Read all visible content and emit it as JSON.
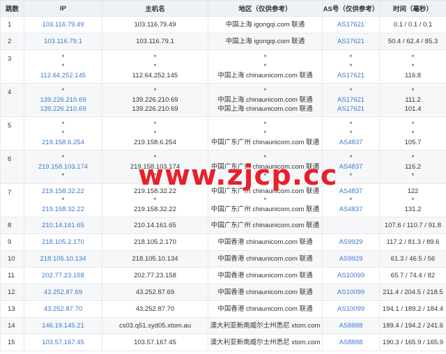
{
  "columns": {
    "hop": "跳数",
    "ip": "IP",
    "hostname": "主机名",
    "region": "地区（仅供参考）",
    "asn": "AS号（仅供参考）",
    "time": "时间（毫秒）"
  },
  "rows": [
    {
      "hop": "1",
      "ip": [
        "103.116.79.49"
      ],
      "host": [
        "103.116.79.49"
      ],
      "region": [
        "中国上海 igongqi.com 联通"
      ],
      "asn": [
        "AS17621"
      ],
      "time": [
        "0.1 / 0.1 / 0.1"
      ]
    },
    {
      "hop": "2",
      "ip": [
        "103.116.79.1"
      ],
      "host": [
        "103.116.79.1"
      ],
      "region": [
        "中国上海 igongqi.com 联通"
      ],
      "asn": [
        "AS17621"
      ],
      "time": [
        "50.4 / 62.4 / 85.3"
      ]
    },
    {
      "hop": "3",
      "ip": [
        "*",
        "*",
        "112.64.252.145"
      ],
      "host": [
        "*",
        "*",
        "112.64.252.145"
      ],
      "region": [
        "*",
        "*",
        "中国上海 chinaunicom.com 联通"
      ],
      "asn": [
        "*",
        "*",
        "AS17621"
      ],
      "time": [
        "*",
        "*",
        "116.8"
      ]
    },
    {
      "hop": "4",
      "ip": [
        "*",
        "139.226.210.69",
        "139.226.210.69"
      ],
      "host": [
        "*",
        "139.226.210.69",
        "139.226.210.69"
      ],
      "region": [
        "*",
        "中国上海 chinaunicom.com 联通",
        "中国上海 chinaunicom.com 联通"
      ],
      "asn": [
        "*",
        "AS17621",
        "AS17621"
      ],
      "time": [
        "*",
        "111.2",
        "101.4"
      ]
    },
    {
      "hop": "5",
      "ip": [
        "*",
        "*",
        "219.158.6.254"
      ],
      "host": [
        "*",
        "*",
        "219.158.6.254"
      ],
      "region": [
        "*",
        "*",
        "中国广东广州 chinaunicom.com 联通"
      ],
      "asn": [
        "*",
        "*",
        "AS4837"
      ],
      "time": [
        "*",
        "*",
        "105.7"
      ]
    },
    {
      "hop": "6",
      "ip": [
        "*",
        "219.158.103.174",
        "*"
      ],
      "host": [
        "*",
        "219.158.103.174",
        "*"
      ],
      "region": [
        "*",
        "中国广东广州 chinaunicom.com 联通",
        "*"
      ],
      "asn": [
        "*",
        "AS4837",
        "*"
      ],
      "time": [
        "*",
        "116.2",
        "*"
      ]
    },
    {
      "hop": "7",
      "ip": [
        "219.158.32.22",
        "*",
        "219.158.32.22"
      ],
      "host": [
        "219.158.32.22",
        "*",
        "219.158.32.22"
      ],
      "region": [
        "中国广东广州 chinaunicom.com 联通",
        "*",
        "中国广东广州 chinaunicom.com 联通"
      ],
      "asn": [
        "AS4837",
        "*",
        "AS4837"
      ],
      "time": [
        "122",
        "*",
        "131.2"
      ]
    },
    {
      "hop": "8",
      "ip": [
        "210.14.161.65"
      ],
      "host": [
        "210.14.161.65"
      ],
      "region": [
        "中国广东广州 chinaunicom.com 联通"
      ],
      "asn": [
        ""
      ],
      "time": [
        "107.6 / 110.7 / 91.8"
      ]
    },
    {
      "hop": "9",
      "ip": [
        "218.105.2.170"
      ],
      "host": [
        "218.105.2.170"
      ],
      "region": [
        "中国香港 chinaunicom.com 联通"
      ],
      "asn": [
        "AS9929"
      ],
      "time": [
        "117.2 / 81.3 / 89.6"
      ]
    },
    {
      "hop": "10",
      "ip": [
        "218.105.10.134"
      ],
      "host": [
        "218.105.10.134"
      ],
      "region": [
        "中国香港 chinaunicom.com 联通"
      ],
      "asn": [
        "AS9929"
      ],
      "time": [
        "61.3 / 46.5 / 56"
      ]
    },
    {
      "hop": "11",
      "ip": [
        "202.77.23.158"
      ],
      "host": [
        "202.77.23.158"
      ],
      "region": [
        "中国香港 chinaunicom.com 联通"
      ],
      "asn": [
        "AS10099"
      ],
      "time": [
        "65.7 / 74.4 / 82"
      ]
    },
    {
      "hop": "12",
      "ip": [
        "43.252.87.69"
      ],
      "host": [
        "43.252.87.69"
      ],
      "region": [
        "中国香港 chinaunicom.com 联通"
      ],
      "asn": [
        "AS10099"
      ],
      "time": [
        "211.4 / 204.5 / 218.5"
      ]
    },
    {
      "hop": "13",
      "ip": [
        "43.252.87.70"
      ],
      "host": [
        "43.252.87.70"
      ],
      "region": [
        "中国香港 chinaunicom.com 联通"
      ],
      "asn": [
        "AS10099"
      ],
      "time": [
        "194.1 / 189.2 / 184.4"
      ]
    },
    {
      "hop": "14",
      "ip": [
        "146.19.145.21"
      ],
      "host": [
        "cs03.q51.syd05.xtom.au"
      ],
      "region": [
        "澳大利亚新南威尔士州悉尼 xtom.com"
      ],
      "asn": [
        "AS8888"
      ],
      "time": [
        "189.4 / 194.2 / 241.6"
      ]
    },
    {
      "hop": "15",
      "ip": [
        "103.57.167.45"
      ],
      "host": [
        "103.57.167.45"
      ],
      "region": [
        "澳大利亚新南威尔士州悉尼 xtom.com"
      ],
      "asn": [
        "AS8888"
      ],
      "time": [
        "190.3 / 165.9 / 165.9"
      ]
    }
  ],
  "watermark": "www.zjcp.cc",
  "colors": {
    "link": "#3a7bc8",
    "header_bg": "#eef1f6",
    "stripe_bg": "#f6f7f9",
    "watermark": "#e8202a"
  }
}
